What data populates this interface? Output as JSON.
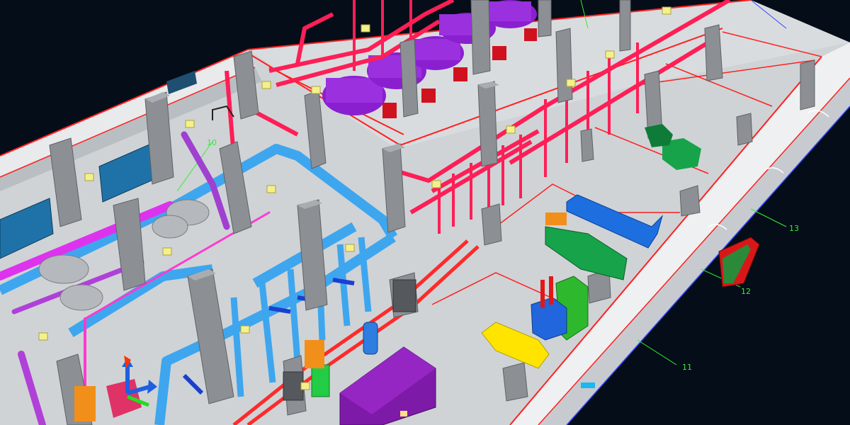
{
  "viewport": {
    "background": "#050d18",
    "grid_labels": [
      "10",
      "11",
      "12",
      "13"
    ]
  },
  "colors": {
    "floor": "#cfd3d6",
    "wall_outline": "#ff2020",
    "column": "#8c9094",
    "sprinkler_pipe": "#ff1e56",
    "chilled_water_pipe": "#3ea6ee",
    "magenta_pipe": "#cc33dd",
    "boiler": "#8a1fd0",
    "generator": "#17a34a",
    "duct": "#1d6fe0",
    "tank": "#7e1aa8",
    "yellow_equipment": "#ffe400",
    "gridline": "#33ee33",
    "window": "#1f72a8"
  },
  "icons": [
    "axis-triad-icon"
  ]
}
